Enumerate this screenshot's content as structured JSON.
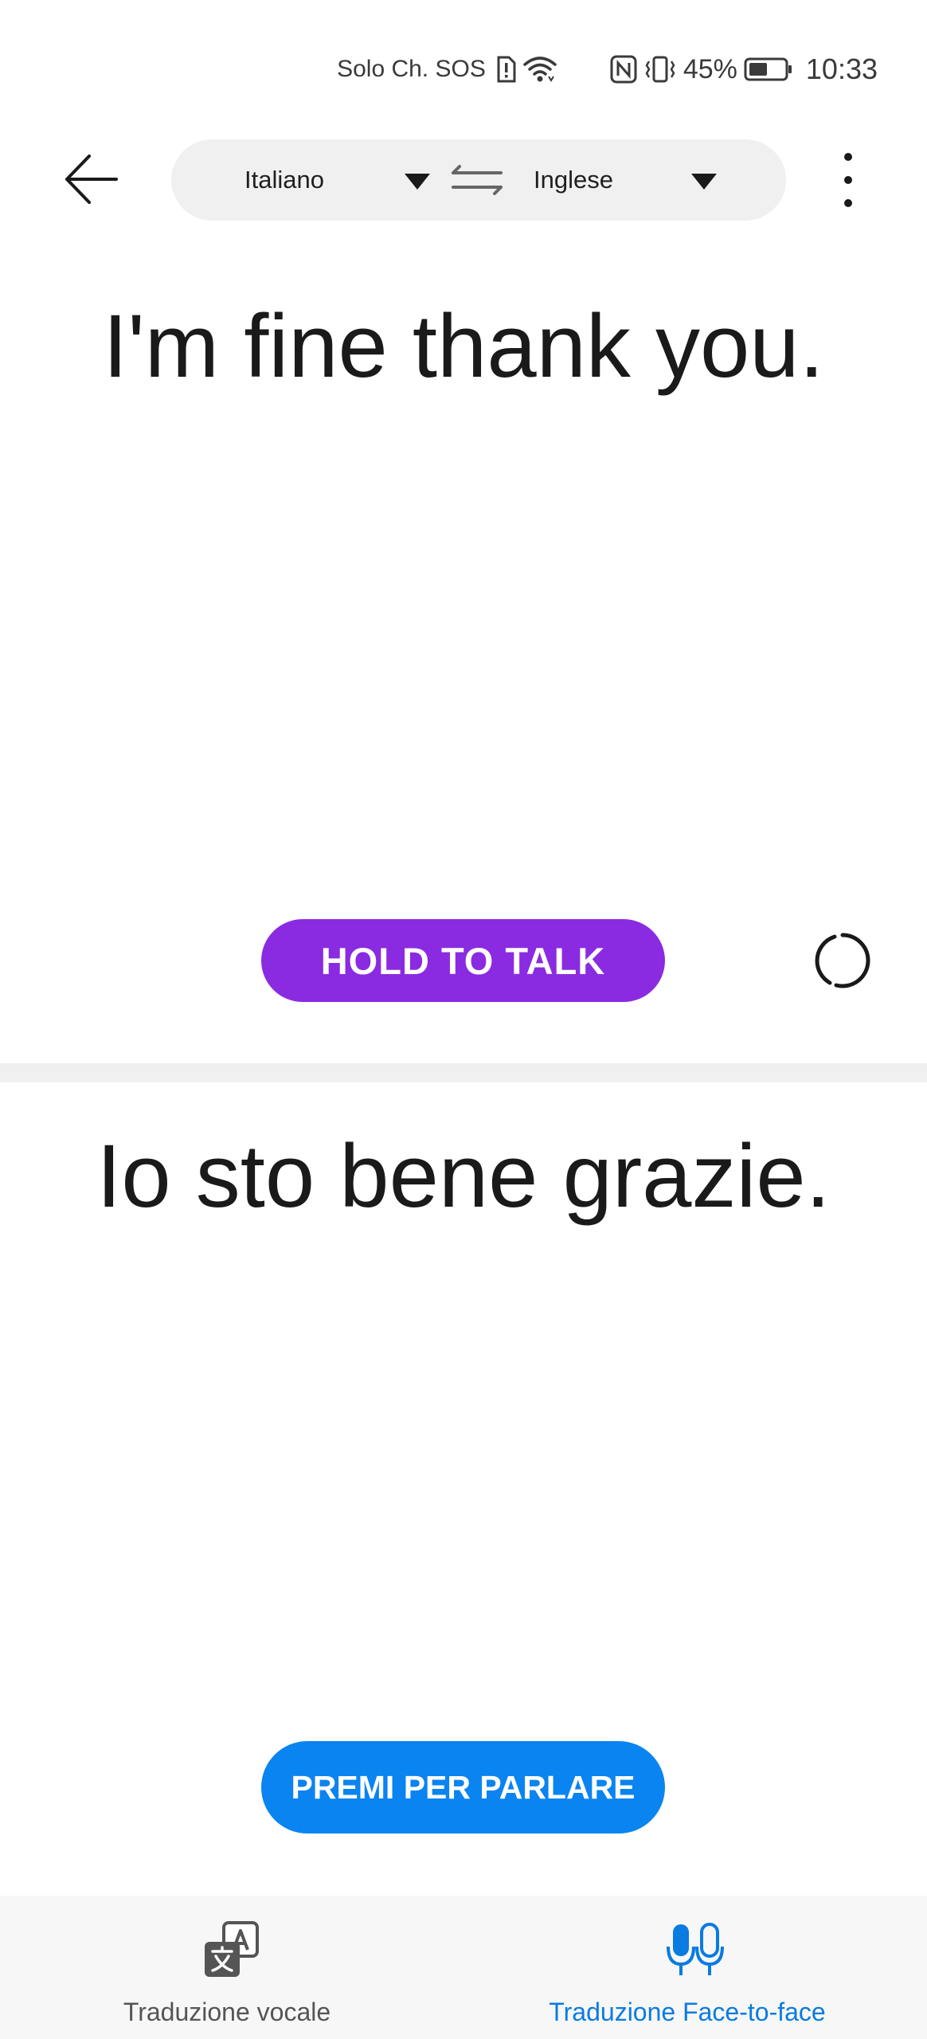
{
  "status_bar": {
    "carrier": "Solo Ch. SOS",
    "battery_percent": "45%",
    "time": "10:33"
  },
  "language_bar": {
    "source_language": "Italiano",
    "target_language": "Inglese"
  },
  "upper_panel": {
    "text": "I'm fine thank you.",
    "button_label": "HOLD TO TALK"
  },
  "lower_panel": {
    "text": "Io sto bene grazie.",
    "button_label": "PREMI PER PARLARE"
  },
  "bottom_nav": {
    "items": [
      {
        "label": "Traduzione vocale",
        "icon": "translate-icon",
        "active": false
      },
      {
        "label": "Traduzione Face-to-face",
        "icon": "dual-mic-icon",
        "active": true
      }
    ]
  },
  "colors": {
    "hold_button": "#8a2be2",
    "talk_button": "#0a84f0",
    "active_nav": "#0a7be0",
    "inactive_nav": "#555555"
  }
}
